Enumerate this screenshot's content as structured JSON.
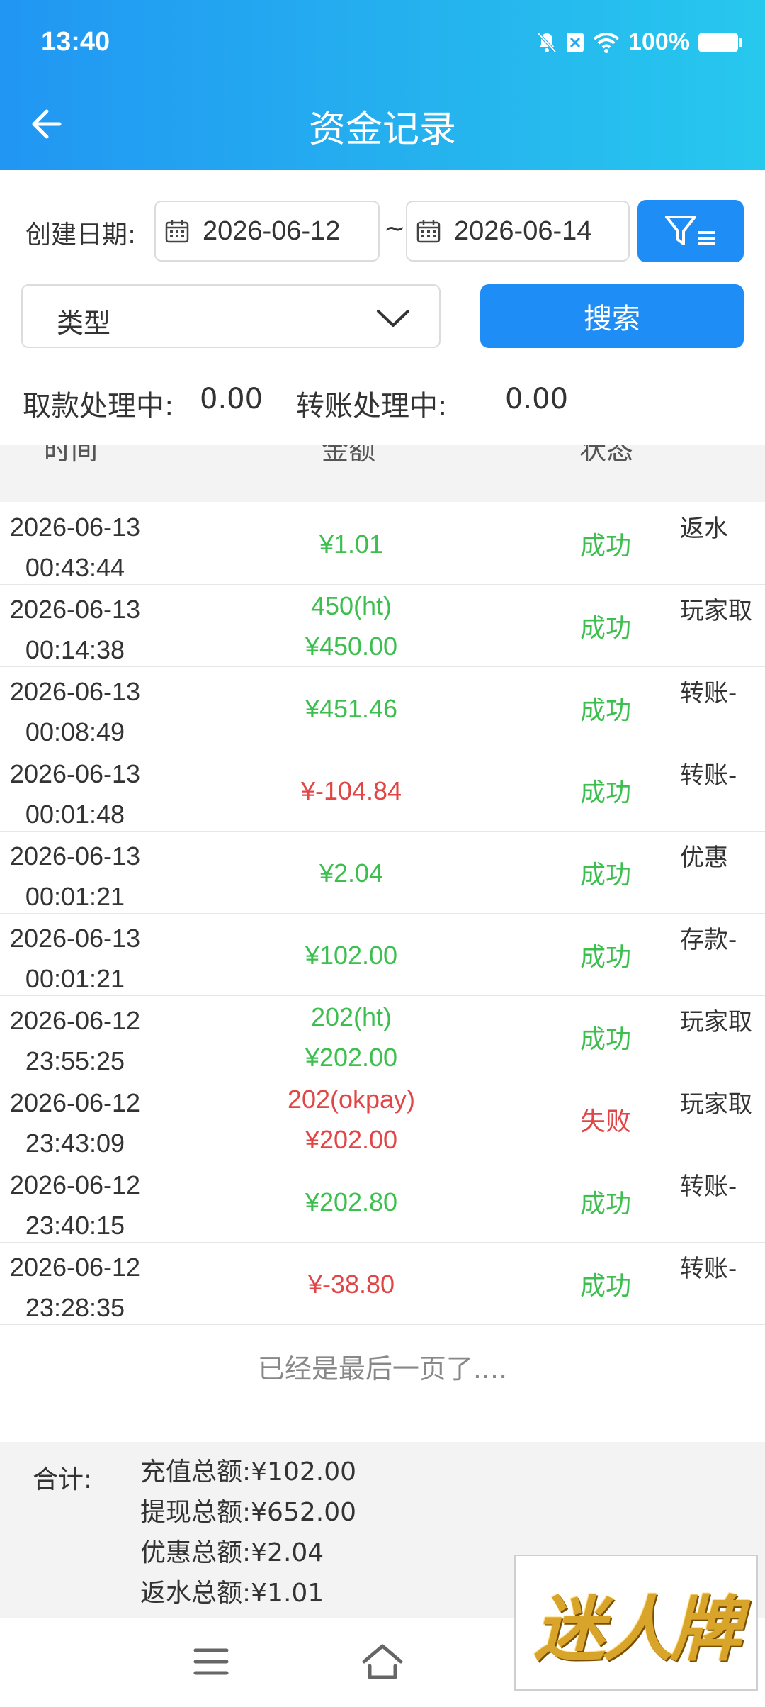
{
  "status_bar": {
    "time": "13:40",
    "battery_pct": "100%"
  },
  "header": {
    "title": "资金记录"
  },
  "filters": {
    "date_label": "创建日期:",
    "start_date": "2026-06-12",
    "separator": "~",
    "end_date": "2026-06-14",
    "type_placeholder": "类型",
    "search_label": "搜索"
  },
  "pending": {
    "withdraw_label": "取款处理中:",
    "withdraw_value": "0.00",
    "transfer_label": "转账处理中:",
    "transfer_value": "0.00"
  },
  "table": {
    "columns": [
      "时间",
      "金额",
      "状态"
    ],
    "rows": [
      {
        "date": "2026-06-13",
        "time": "00:43:44",
        "amount_line1": "¥1.01",
        "amount_line2": "",
        "amount_color": "green",
        "status": "成功",
        "status_color": "green",
        "type": "返水"
      },
      {
        "date": "2026-06-13",
        "time": "00:14:38",
        "amount_line1": "450(ht)",
        "amount_line2": "¥450.00",
        "amount_color": "green",
        "status": "成功",
        "status_color": "green",
        "type": "玩家取"
      },
      {
        "date": "2026-06-13",
        "time": "00:08:49",
        "amount_line1": "¥451.46",
        "amount_line2": "",
        "amount_color": "green",
        "status": "成功",
        "status_color": "green",
        "type": "转账-"
      },
      {
        "date": "2026-06-13",
        "time": "00:01:48",
        "amount_line1": "¥-104.84",
        "amount_line2": "",
        "amount_color": "red",
        "status": "成功",
        "status_color": "green",
        "type": "转账-"
      },
      {
        "date": "2026-06-13",
        "time": "00:01:21",
        "amount_line1": "¥2.04",
        "amount_line2": "",
        "amount_color": "green",
        "status": "成功",
        "status_color": "green",
        "type": "优惠"
      },
      {
        "date": "2026-06-13",
        "time": "00:01:21",
        "amount_line1": "¥102.00",
        "amount_line2": "",
        "amount_color": "green",
        "status": "成功",
        "status_color": "green",
        "type": "存款-"
      },
      {
        "date": "2026-06-12",
        "time": "23:55:25",
        "amount_line1": "202(ht)",
        "amount_line2": "¥202.00",
        "amount_color": "green",
        "status": "成功",
        "status_color": "green",
        "type": "玩家取"
      },
      {
        "date": "2026-06-12",
        "time": "23:43:09",
        "amount_line1": "202(okpay)",
        "amount_line2": "¥202.00",
        "amount_color": "red",
        "status": "失败",
        "status_color": "red",
        "type": "玩家取"
      },
      {
        "date": "2026-06-12",
        "time": "23:40:15",
        "amount_line1": "¥202.80",
        "amount_line2": "",
        "amount_color": "green",
        "status": "成功",
        "status_color": "green",
        "type": "转账-"
      },
      {
        "date": "2026-06-12",
        "time": "23:28:35",
        "amount_line1": "¥-38.80",
        "amount_line2": "",
        "amount_color": "red",
        "status": "成功",
        "status_color": "green",
        "type": "转账-"
      }
    ],
    "end_note": "已经是最后一页了...."
  },
  "summary": {
    "label": "合计:",
    "lines": [
      "充值总额:¥102.00",
      "提现总额:¥652.00",
      "优惠总额:¥2.04",
      "返水总额:¥1.01"
    ]
  },
  "logo": {
    "text": "迷人牌"
  },
  "colors": {
    "primary": "#1e8df5",
    "success": "#3cbf4e",
    "fail": "#e14545"
  }
}
